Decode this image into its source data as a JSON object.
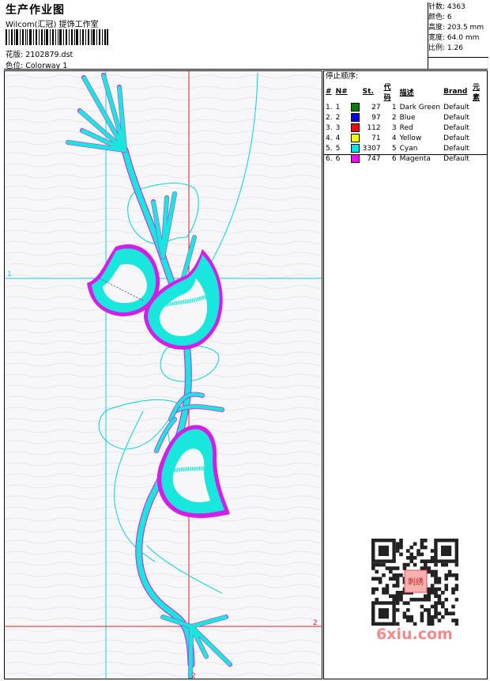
{
  "header": {
    "title": "生产作业图",
    "subtitle": "Wilcom(汇冠) 提饰工作室",
    "design_line": "花版: 2102879.dst",
    "colorway_line": "色位: Colorway 1"
  },
  "stats": [
    {
      "label": "针数:",
      "value": "4363"
    },
    {
      "label": "颜色:",
      "value": "6"
    },
    {
      "label": "高度:",
      "value": "203.5 mm"
    },
    {
      "label": "宽度:",
      "value": "64.0 mm"
    },
    {
      "label": "比例:",
      "value": "1.26"
    }
  ],
  "stop_sequence": {
    "heading": "停止顺序:",
    "columns": [
      "#",
      "N#",
      "St.",
      "代码",
      "描述",
      "Brand",
      "元素"
    ],
    "rows": [
      {
        "idx": "1.",
        "n": "1",
        "color": "#008000",
        "st": "27",
        "code": "1",
        "desc": "Dark Green",
        "brand": "Default"
      },
      {
        "idx": "2.",
        "n": "2",
        "color": "#0000ff",
        "st": "97",
        "code": "2",
        "desc": "Blue",
        "brand": "Default"
      },
      {
        "idx": "3.",
        "n": "3",
        "color": "#ff0000",
        "st": "112",
        "code": "3",
        "desc": "Red",
        "brand": "Default"
      },
      {
        "idx": "4.",
        "n": "4",
        "color": "#ffff00",
        "st": "71",
        "code": "4",
        "desc": "Yellow",
        "brand": "Default"
      },
      {
        "idx": "5.",
        "n": "5",
        "color": "#00e5e5",
        "st": "3307",
        "code": "5",
        "desc": "Cyan",
        "brand": "Default"
      },
      {
        "idx": "6.",
        "n": "6",
        "color": "#ff00ff",
        "st": "747",
        "code": "6",
        "desc": "Magenta",
        "brand": "Default"
      }
    ]
  },
  "axes": {
    "h_label_1": "1",
    "h_label_2": "2",
    "v_label_2": "2"
  },
  "watermark": "6xiu.com",
  "qr_badge": "刺绣",
  "colors": {
    "stitch": "#19e6dc",
    "outline": "#d21ee6",
    "guide_cyan": "#19d2dc",
    "guide_red": "#e01e28"
  }
}
